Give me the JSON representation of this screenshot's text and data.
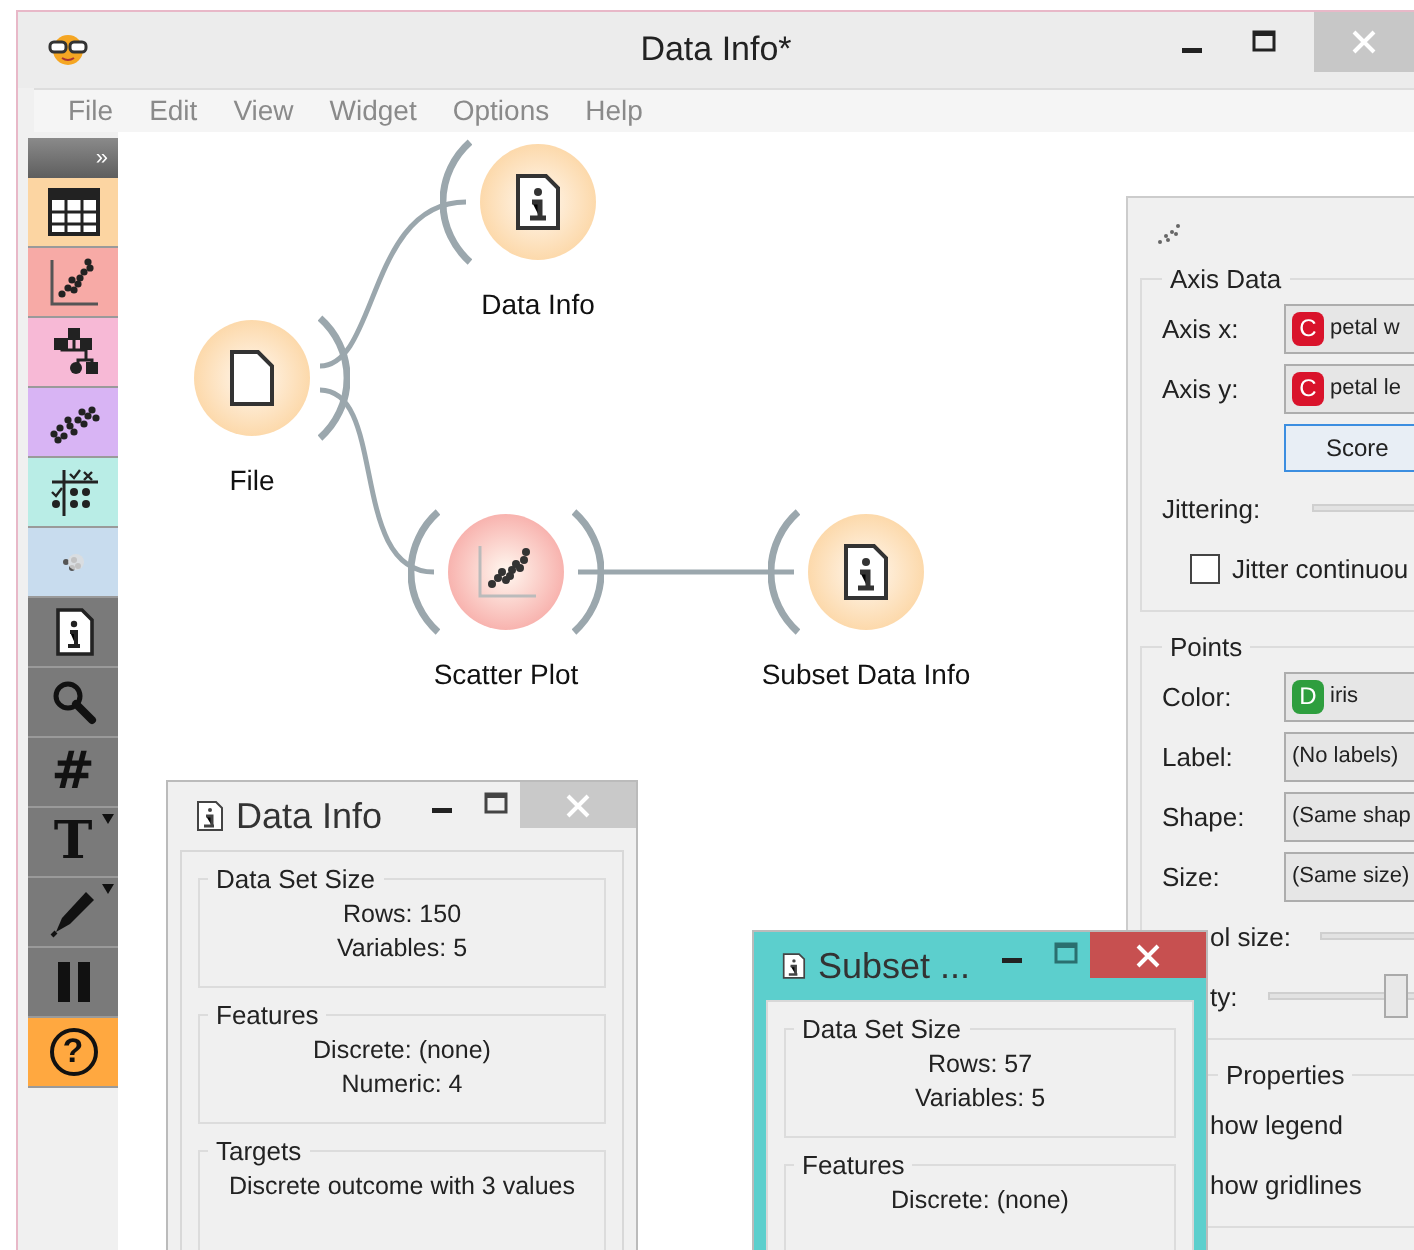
{
  "window": {
    "title": "Data Info*"
  },
  "menu": [
    "File",
    "Edit",
    "View",
    "Widget",
    "Options",
    "Help"
  ],
  "toolbox": {
    "expand": "»",
    "items": [
      {
        "kind": "table",
        "color": "#fcd5a2"
      },
      {
        "kind": "scatter",
        "color": "#f7aaa6"
      },
      {
        "kind": "tree",
        "color": "#f7b9d6"
      },
      {
        "kind": "cluster",
        "color": "#d8b4f4"
      },
      {
        "kind": "grid",
        "color": "#b9ede6"
      },
      {
        "kind": "dots",
        "color": "#c8dcee"
      },
      {
        "kind": "info"
      },
      {
        "kind": "search"
      },
      {
        "kind": "glyph",
        "glyph": "#"
      },
      {
        "kind": "glyph",
        "glyph": "T",
        "menu": true
      },
      {
        "kind": "pen",
        "menu": true
      },
      {
        "kind": "pause"
      },
      {
        "kind": "help",
        "glyph": "?"
      }
    ]
  },
  "nodes": [
    {
      "label": "File",
      "kind": "file",
      "color": "#fcd5a2"
    },
    {
      "label": "Data Info",
      "kind": "info",
      "color": "#fcd5a2"
    },
    {
      "label": "Scatter Plot",
      "kind": "scatter",
      "color": "#f7aaa6"
    },
    {
      "label": "Subset Data Info",
      "kind": "info",
      "color": "#fcd5a2"
    }
  ],
  "scatter_window": {
    "groups": [
      {
        "title": "Axis Data",
        "rows": [
          {
            "kind": "combo",
            "label": "Axis x:",
            "badge": "C",
            "color": "#d9132b",
            "value": "petal w"
          },
          {
            "kind": "combo",
            "label": "Axis y:",
            "badge": "C",
            "color": "#d9132b",
            "value": "petal le"
          },
          {
            "kind": "button",
            "value": "Score"
          },
          {
            "kind": "slider",
            "label": "Jittering:"
          },
          {
            "kind": "check",
            "label": "Jitter continuou",
            "checked": false
          }
        ]
      },
      {
        "title": "Points",
        "rows": [
          {
            "kind": "combo",
            "label": "Color:",
            "badge": "D",
            "color": "#2e9e3e",
            "value": "iris"
          },
          {
            "kind": "combo",
            "label": "Label:",
            "value": "(No labels)"
          },
          {
            "kind": "combo",
            "label": "Shape:",
            "value": "(Same shap"
          },
          {
            "kind": "combo",
            "label": "Size:",
            "value": "(Same size)"
          },
          {
            "kind": "slider",
            "label": "ol size:",
            "hidden_start": true
          },
          {
            "kind": "slider",
            "label": "ty:",
            "hidden_start": true,
            "level": 0.75
          }
        ]
      },
      {
        "title": "Properties",
        "hidden_start": true,
        "rows": [
          {
            "kind": "text",
            "label": "how legend",
            "hidden_start": true
          },
          {
            "kind": "text",
            "label": "how gridlines",
            "hidden_start": true
          }
        ]
      }
    ]
  },
  "data_info_window": {
    "title": "Data Info",
    "groups": [
      {
        "title": "Data Set Size",
        "lines": [
          "Rows: 150",
          "Variables: 5"
        ]
      },
      {
        "title": "Features",
        "lines": [
          "Discrete: (none)",
          "Numeric: 4"
        ]
      },
      {
        "title": "Targets",
        "lines": [
          "Discrete outcome with 3 values"
        ]
      }
    ]
  },
  "subset_window": {
    "title": "Subset ...",
    "groups": [
      {
        "title": "Data Set Size",
        "lines": [
          "Rows: 57",
          "Variables: 5"
        ]
      },
      {
        "title": "Features",
        "lines": [
          "Discrete: (none)"
        ]
      }
    ]
  }
}
